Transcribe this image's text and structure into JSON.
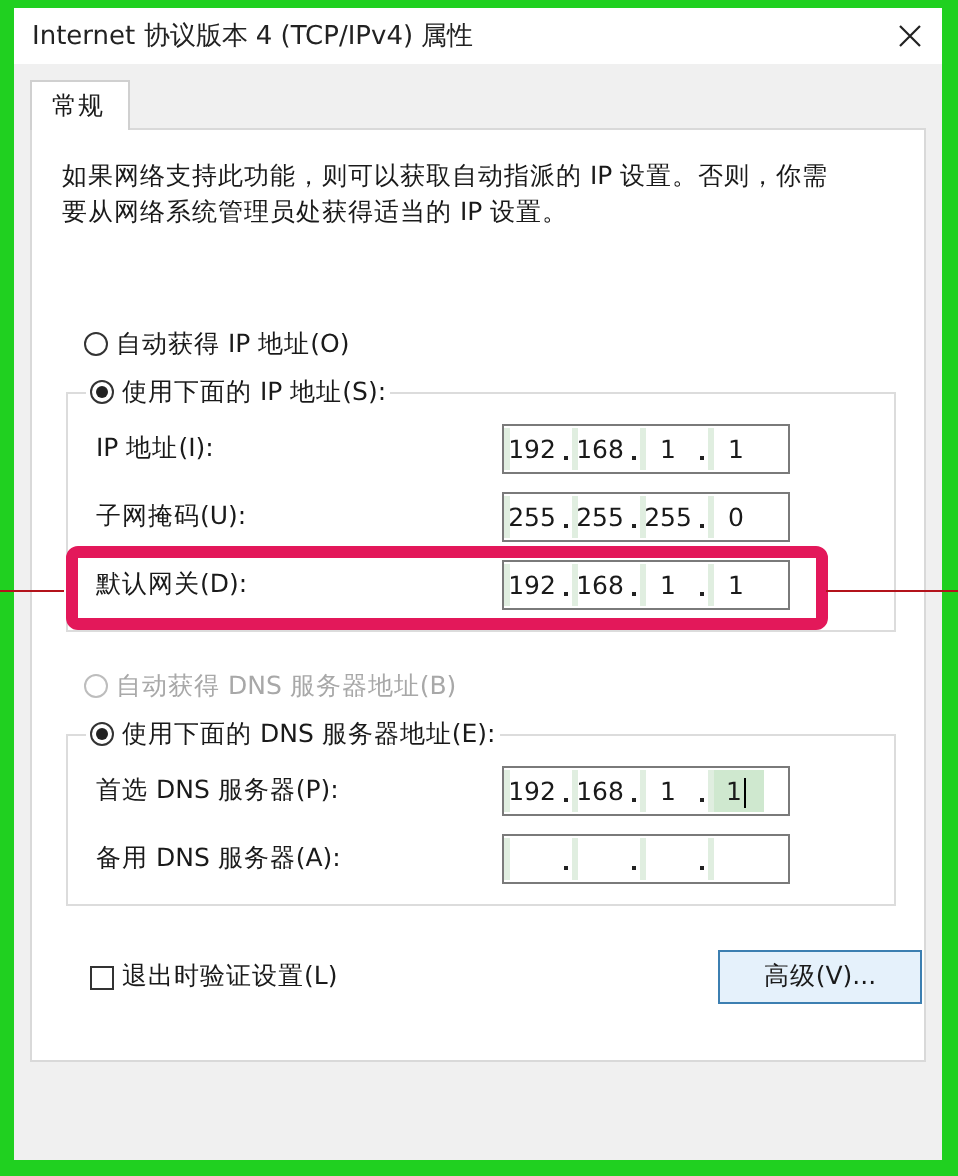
{
  "window": {
    "title": "Internet 协议版本 4 (TCP/IPv4) 属性"
  },
  "tabs": [
    {
      "label": "常规",
      "selected": true
    }
  ],
  "description": "如果网络支持此功能，则可以获取自动指派的 IP 设置。否则，你需要从网络系统管理员处获得适当的 IP 设置。",
  "ip_mode": [
    {
      "label": "自动获得 IP 地址(O)",
      "selected": false,
      "disabled": false
    },
    {
      "label": "使用下面的 IP 地址(S):",
      "selected": true,
      "disabled": false
    }
  ],
  "ip_fields": [
    {
      "label": "IP 地址(I):",
      "octets": [
        "192",
        "168",
        "1",
        "1"
      ],
      "highlighted": false,
      "focused": false
    },
    {
      "label": "子网掩码(U):",
      "octets": [
        "255",
        "255",
        "255",
        "0"
      ],
      "highlighted": false,
      "focused": false
    },
    {
      "label": "默认网关(D):",
      "octets": [
        "192",
        "168",
        "1",
        "1"
      ],
      "highlighted": true,
      "focused": false
    }
  ],
  "dns_mode": [
    {
      "label": "自动获得 DNS 服务器地址(B)",
      "selected": false,
      "disabled": true
    },
    {
      "label": "使用下面的 DNS 服务器地址(E):",
      "selected": true,
      "disabled": false
    }
  ],
  "dns_fields": [
    {
      "label": "首选 DNS 服务器(P):",
      "octets": [
        "192",
        "168",
        "1",
        "1"
      ],
      "highlighted": false,
      "focused": true
    },
    {
      "label": "备用 DNS 服务器(A):",
      "highlighted": false,
      "focused": false
    }
  ],
  "validate": {
    "label": "退出时验证设置(L)",
    "checked": false
  },
  "advanced_button": "高级(V)..."
}
